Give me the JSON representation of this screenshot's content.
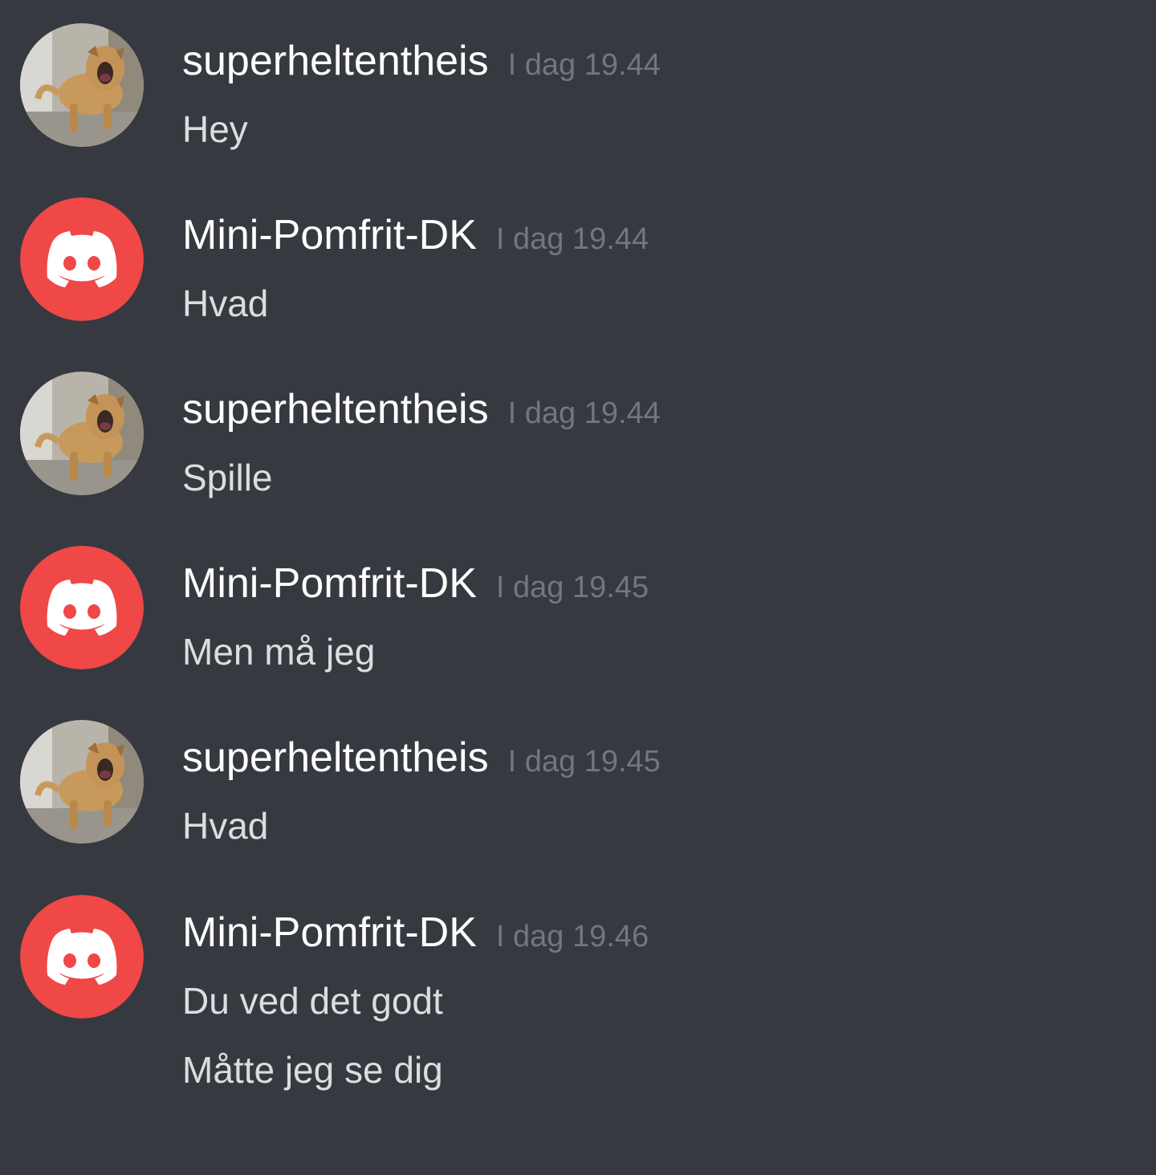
{
  "colors": {
    "background": "#36393f",
    "username": "#ffffff",
    "timestamp": "#72767d",
    "message_text": "#dcddde",
    "default_avatar": "#f04747"
  },
  "messages": [
    {
      "author": "superheltentheis",
      "avatar": "dog-photo-avatar",
      "timestamp": "I dag 19.44",
      "lines": [
        "Hey"
      ]
    },
    {
      "author": "Mini-Pomfrit-DK",
      "avatar": "discord-logo-avatar",
      "timestamp": "I dag 19.44",
      "lines": [
        "Hvad"
      ]
    },
    {
      "author": "superheltentheis",
      "avatar": "dog-photo-avatar",
      "timestamp": "I dag 19.44",
      "lines": [
        "Spille"
      ]
    },
    {
      "author": "Mini-Pomfrit-DK",
      "avatar": "discord-logo-avatar",
      "timestamp": "I dag 19.45",
      "lines": [
        "Men må jeg"
      ]
    },
    {
      "author": "superheltentheis",
      "avatar": "dog-photo-avatar",
      "timestamp": "I dag 19.45",
      "lines": [
        "Hvad"
      ]
    },
    {
      "author": "Mini-Pomfrit-DK",
      "avatar": "discord-logo-avatar",
      "timestamp": "I dag 19.46",
      "lines": [
        "Du ved det godt",
        "Måtte jeg se dig"
      ]
    }
  ]
}
